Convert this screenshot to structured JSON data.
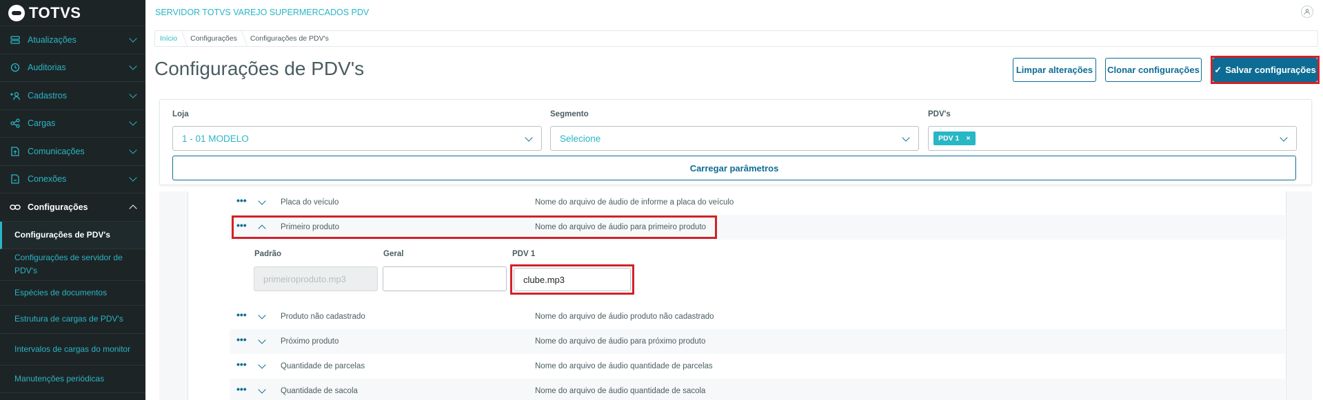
{
  "sidebar": {
    "logo_text": "TOTVS",
    "items": [
      {
        "label": "Atualizações",
        "icon": "server-icon"
      },
      {
        "label": "Auditorias",
        "icon": "history-icon"
      },
      {
        "label": "Cadastros",
        "icon": "add-user-icon"
      },
      {
        "label": "Cargas",
        "icon": "share-icon"
      },
      {
        "label": "Comunicações",
        "icon": "doc-upload-icon"
      },
      {
        "label": "Conexões",
        "icon": "doc-link-icon"
      },
      {
        "label": "Configurações",
        "icon": "link-icon"
      }
    ],
    "sub_items": [
      "Configurações de PDV's",
      "Configurações de servidor de PDV's",
      "Espécies de documentos",
      "Estrutura de cargas de PDV's",
      "Intervalos de cargas do monitor",
      "Manutenções periódicas"
    ]
  },
  "header": {
    "app_title": "SERVIDOR TOTVS VAREJO SUPERMERCADOS PDV",
    "user_icon": "user-icon"
  },
  "breadcrumb": [
    "Início",
    "Configurações",
    "Configurações de PDV's"
  ],
  "page": {
    "title": "Configurações de PDV's",
    "btn_clear": "Limpar alterações",
    "btn_clone": "Clonar configurações",
    "btn_save": "Salvar configurações"
  },
  "filters": {
    "loja_label": "Loja",
    "loja_value": "1 - 01 MODELO",
    "segmento_label": "Segmento",
    "segmento_value": "Selecione",
    "pdvs_label": "PDV's",
    "pdvs_tag": "PDV 1",
    "load_button": "Carregar parâmetros"
  },
  "params": [
    {
      "name": "Placa do veículo",
      "desc": "Nome do arquivo de áudio de informe a placa do veículo"
    },
    {
      "name": "Primeiro produto",
      "desc": "Nome do arquivo de áudio para primeiro produto"
    },
    {
      "name": "Produto não cadastrado",
      "desc": "Nome do arquivo de áudio produto não cadastrado"
    },
    {
      "name": "Próximo produto",
      "desc": "Nome do arquivo de áudio para próximo produto"
    },
    {
      "name": "Quantidade de parcelas",
      "desc": "Nome do arquivo de áudio quantidade de parcelas"
    },
    {
      "name": "Quantidade de sacola",
      "desc": "Nome do arquivo de áudio quantidade de sacola"
    }
  ],
  "detail": {
    "padrao_label": "Padrão",
    "padrao_value": "primeiroproduto.mp3",
    "geral_label": "Geral",
    "geral_value": "",
    "pdv_label": "PDV 1",
    "pdv_value": "clube.mp3"
  },
  "colors": {
    "sidebar_bg": "#1d2426",
    "accent": "#29b6c5",
    "primary": "#0c6c94",
    "highlight": "#d42027"
  }
}
